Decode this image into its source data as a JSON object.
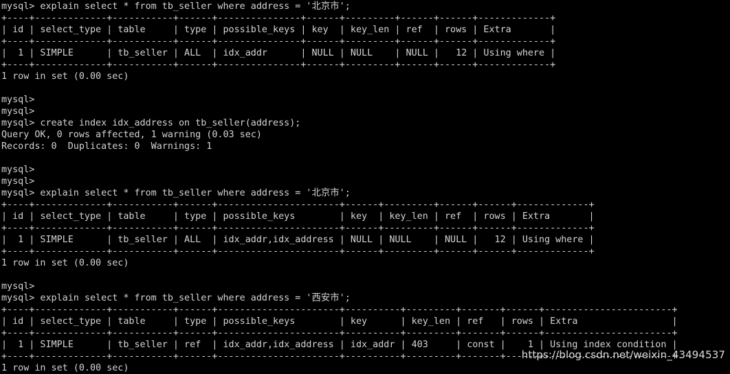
{
  "terminal": {
    "background_color": "#000000",
    "foreground_color": "#d4d4d4",
    "prompt": "mysql>",
    "lines": [
      "mysql> explain select * from tb_seller where address = '北京市';",
      "+----+-------------+-----------+------+---------------+------+---------+------+------+-------------+",
      "| id | select_type | table     | type | possible_keys | key  | key_len | ref  | rows | Extra       |",
      "+----+-------------+-----------+------+---------------+------+---------+------+------+-------------+",
      "|  1 | SIMPLE      | tb_seller | ALL  | idx_addr      | NULL | NULL    | NULL |   12 | Using where |",
      "+----+-------------+-----------+------+---------------+------+---------+------+------+-------------+",
      "1 row in set (0.00 sec)",
      "",
      "mysql>",
      "mysql>",
      "mysql> create index idx_address on tb_seller(address);",
      "Query OK, 0 rows affected, 1 warning (0.03 sec)",
      "Records: 0  Duplicates: 0  Warnings: 1",
      "",
      "mysql>",
      "mysql>",
      "mysql> explain select * from tb_seller where address = '北京市';",
      "+----+-------------+-----------+------+----------------------+------+---------+------+------+-------------+",
      "| id | select_type | table     | type | possible_keys        | key  | key_len | ref  | rows | Extra       |",
      "+----+-------------+-----------+------+----------------------+------+---------+------+------+-------------+",
      "|  1 | SIMPLE      | tb_seller | ALL  | idx_addr,idx_address | NULL | NULL    | NULL |   12 | Using where |",
      "+----+-------------+-----------+------+----------------------+------+---------+------+------+-------------+",
      "1 row in set (0.00 sec)",
      "",
      "mysql>",
      "mysql> explain select * from tb_seller where address = '西安市';",
      "+----+-------------+-----------+------+----------------------+----------+---------+-------+------+-----------------------+",
      "| id | select_type | table     | type | possible_keys        | key      | key_len | ref   | rows | Extra                 |",
      "+----+-------------+-----------+------+----------------------+----------+---------+-------+------+-----------------------+",
      "|  1 | SIMPLE      | tb_seller | ref  | idx_addr,idx_address | idx_addr | 403     | const |    1 | Using index condition |",
      "+----+-------------+-----------+------+----------------------+----------+---------+-------+------+-----------------------+",
      "1 row in set (0.00 sec)"
    ]
  },
  "queries": [
    {
      "sql": "explain select * from tb_seller where address = '北京市';",
      "result_status": "1 row in set (0.00 sec)",
      "columns": [
        "id",
        "select_type",
        "table",
        "type",
        "possible_keys",
        "key",
        "key_len",
        "ref",
        "rows",
        "Extra"
      ],
      "rows": [
        [
          "1",
          "SIMPLE",
          "tb_seller",
          "ALL",
          "idx_addr",
          "NULL",
          "NULL",
          "NULL",
          "12",
          "Using where"
        ]
      ]
    },
    {
      "sql": "create index idx_address on tb_seller(address);",
      "result_status": "Query OK, 0 rows affected, 1 warning (0.03 sec)",
      "detail": "Records: 0  Duplicates: 0  Warnings: 1"
    },
    {
      "sql": "explain select * from tb_seller where address = '北京市';",
      "result_status": "1 row in set (0.00 sec)",
      "columns": [
        "id",
        "select_type",
        "table",
        "type",
        "possible_keys",
        "key",
        "key_len",
        "ref",
        "rows",
        "Extra"
      ],
      "rows": [
        [
          "1",
          "SIMPLE",
          "tb_seller",
          "ALL",
          "idx_addr,idx_address",
          "NULL",
          "NULL",
          "NULL",
          "12",
          "Using where"
        ]
      ]
    },
    {
      "sql": "explain select * from tb_seller where address = '西安市';",
      "result_status": "1 row in set (0.00 sec)",
      "columns": [
        "id",
        "select_type",
        "table",
        "type",
        "possible_keys",
        "key",
        "key_len",
        "ref",
        "rows",
        "Extra"
      ],
      "rows": [
        [
          "1",
          "SIMPLE",
          "tb_seller",
          "ref",
          "idx_addr,idx_address",
          "idx_addr",
          "403",
          "const",
          "1",
          "Using index condition"
        ]
      ]
    }
  ],
  "watermark": {
    "text": "https://blog.csdn.net/weixin_43494537"
  }
}
